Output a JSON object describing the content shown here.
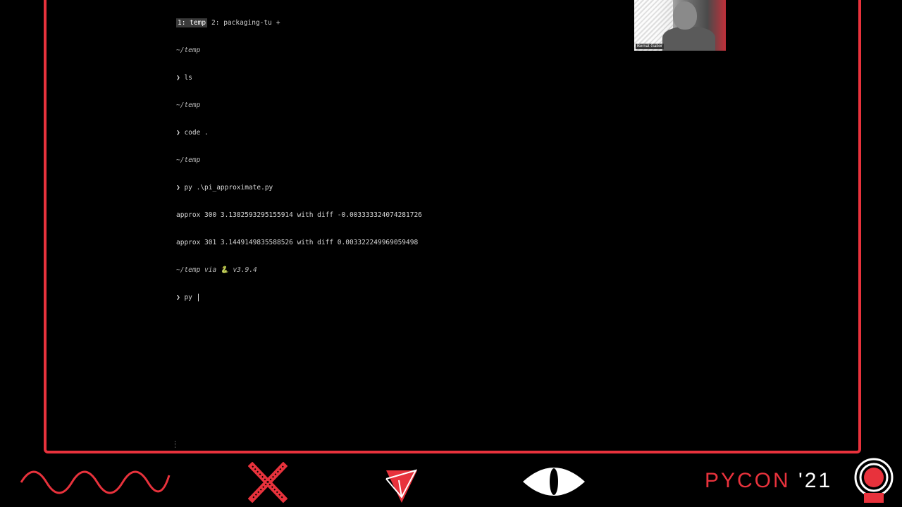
{
  "terminal": {
    "tabs": [
      {
        "label": "1: temp",
        "active": true
      },
      {
        "label": "2: packaging-tu",
        "active": false
      }
    ],
    "new_tab_label": "+",
    "lines": [
      {
        "kind": "path",
        "text": "~/temp"
      },
      {
        "kind": "cmd",
        "text": "❯ ls"
      },
      {
        "kind": "path",
        "text": "~/temp"
      },
      {
        "kind": "cmd",
        "text": "❯ code ."
      },
      {
        "kind": "path",
        "text": "~/temp"
      },
      {
        "kind": "cmd",
        "text": "❯ py .\\pi_approximate.py"
      },
      {
        "kind": "out",
        "text": "approx 300 3.1382593295155914 with diff -0.003333324074281726"
      },
      {
        "kind": "out",
        "text": "approx 301 3.1449149835588526 with diff 0.003322249969059498"
      },
      {
        "kind": "path",
        "text": "~/temp via 🐍 v3.9.4"
      }
    ],
    "current_input": "❯ py "
  },
  "webcam": {
    "speaker_name": "Bernat Gabor"
  },
  "branding": {
    "pycon_text": "PYCON",
    "year_text": "'21",
    "accent_color": "#e8323c",
    "icons": [
      "wave-icon",
      "x-icon",
      "triangle-icon",
      "eye-icon",
      "target-icon"
    ]
  }
}
